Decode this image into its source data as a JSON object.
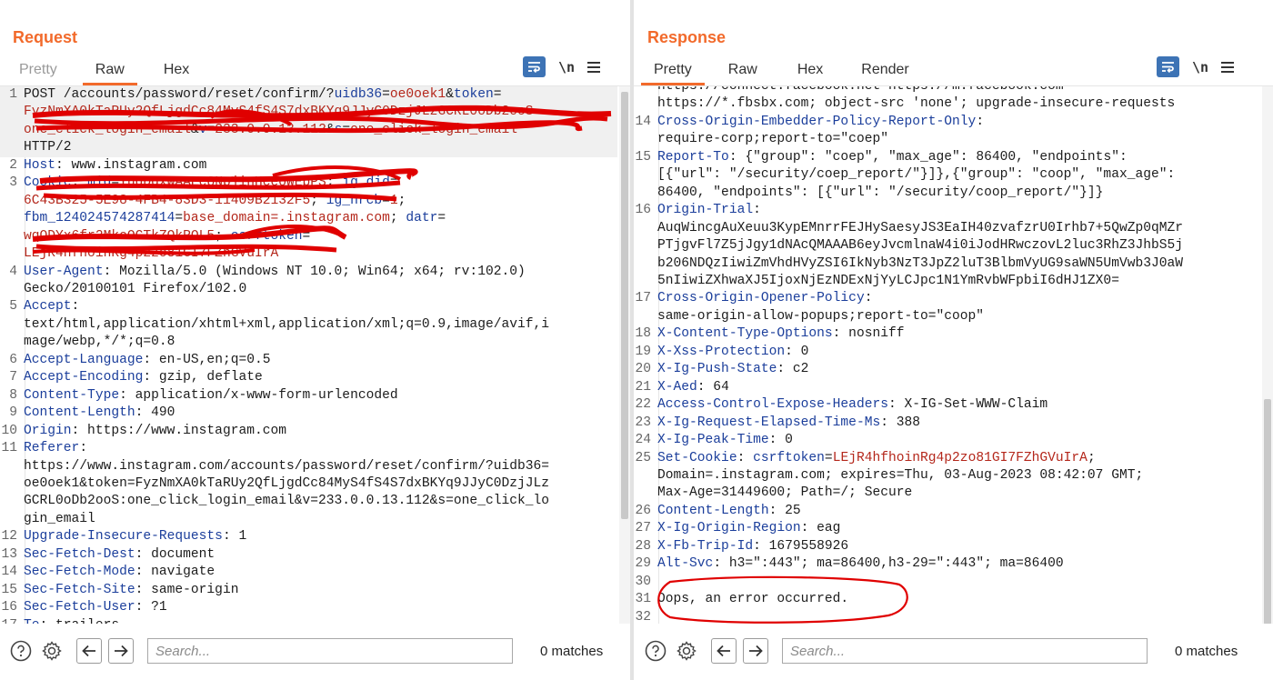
{
  "layout_toggle": {
    "options": [
      "side-by-side",
      "horizontal",
      "single"
    ],
    "active": "side-by-side"
  },
  "request": {
    "title": "Request",
    "tabs": [
      {
        "label": "Pretty",
        "active": false,
        "disabled": true
      },
      {
        "label": "Raw",
        "active": true,
        "disabled": false
      },
      {
        "label": "Hex",
        "active": false,
        "disabled": false
      }
    ],
    "newline_label": "\\n",
    "lines": [
      {
        "n": "1",
        "cur": true,
        "segs": [
          [
            "t",
            "POST /accounts/password/reset/confirm/?"
          ],
          [
            "k",
            "uidb36"
          ],
          [
            "t",
            "="
          ],
          [
            "v",
            "oe0oek1"
          ],
          [
            "t",
            "&"
          ],
          [
            "k",
            "token"
          ],
          [
            "t",
            "="
          ]
        ]
      },
      {
        "n": "",
        "cur": true,
        "segs": [
          [
            "v",
            "FyzNmXA0kTaRUy2QfLjgdCc84MyS4fS4S7dxBKYq9JJyC0DzjJLzGCRL0oDb2ooS"
          ]
        ]
      },
      {
        "n": "",
        "cur": true,
        "segs": [
          [
            "v",
            "one_click_login_email"
          ],
          [
            "t",
            "&"
          ],
          [
            "k",
            "v"
          ],
          [
            "t",
            "="
          ],
          [
            "v",
            "233.0.0.13.112"
          ],
          [
            "t",
            "&"
          ],
          [
            "k",
            "s"
          ],
          [
            "t",
            "="
          ],
          [
            "v",
            "one_click_login_email"
          ]
        ]
      },
      {
        "n": "",
        "cur": true,
        "segs": [
          [
            "t",
            "HTTP/2"
          ]
        ]
      },
      {
        "n": "2",
        "segs": [
          [
            "h",
            "Host"
          ],
          [
            "t",
            ": www.instagram.com"
          ]
        ]
      },
      {
        "n": "3",
        "segs": [
          [
            "h",
            "Cookie"
          ],
          [
            "t",
            ": "
          ],
          [
            "k",
            "mid"
          ],
          [
            "t",
            "="
          ],
          [
            "v",
            "YuqDqxWAAEc8NpjinHceoWEbPS"
          ],
          [
            "t",
            "; "
          ],
          [
            "k",
            "ig_did"
          ],
          [
            "t",
            "="
          ]
        ]
      },
      {
        "n": "",
        "segs": [
          [
            "v",
            "6C43B325-5E98-4FB4-83D3-11409B2132F5"
          ],
          [
            "t",
            "; "
          ],
          [
            "k",
            "ig_nrcb"
          ],
          [
            "t",
            "="
          ],
          [
            "v",
            "1"
          ],
          [
            "t",
            ";"
          ]
        ]
      },
      {
        "n": "",
        "segs": [
          [
            "k",
            "fbm_124024574287414"
          ],
          [
            "t",
            "="
          ],
          [
            "v",
            "base_domain=.instagram.com"
          ],
          [
            "t",
            "; "
          ],
          [
            "k",
            "datr"
          ],
          [
            "t",
            "="
          ]
        ]
      },
      {
        "n": "",
        "segs": [
          [
            "v",
            "wqODYx6fr2MkoOCTkZQkROL5"
          ],
          [
            "t",
            "; "
          ],
          [
            "k",
            "csrftoken"
          ],
          [
            "t",
            "="
          ]
        ]
      },
      {
        "n": "",
        "segs": [
          [
            "v",
            "LEjR4hfhoinRg4p2zo81GI7FZhGVuIrA"
          ]
        ]
      },
      {
        "n": "4",
        "segs": [
          [
            "h",
            "User-Agent"
          ],
          [
            "t",
            ": Mozilla/5.0 (Windows NT 10.0; Win64; x64; rv:102.0)"
          ]
        ]
      },
      {
        "n": "",
        "segs": [
          [
            "t",
            "Gecko/20100101 Firefox/102.0"
          ]
        ]
      },
      {
        "n": "5",
        "segs": [
          [
            "h",
            "Accept"
          ],
          [
            "t",
            ":"
          ]
        ]
      },
      {
        "n": "",
        "segs": [
          [
            "t",
            "text/html,application/xhtml+xml,application/xml;q=0.9,image/avif,i"
          ]
        ]
      },
      {
        "n": "",
        "segs": [
          [
            "t",
            "mage/webp,*/*;q=0.8"
          ]
        ]
      },
      {
        "n": "6",
        "segs": [
          [
            "h",
            "Accept-Language"
          ],
          [
            "t",
            ": en-US,en;q=0.5"
          ]
        ]
      },
      {
        "n": "7",
        "segs": [
          [
            "h",
            "Accept-Encoding"
          ],
          [
            "t",
            ": gzip, deflate"
          ]
        ]
      },
      {
        "n": "8",
        "segs": [
          [
            "h",
            "Content-Type"
          ],
          [
            "t",
            ": application/x-www-form-urlencoded"
          ]
        ]
      },
      {
        "n": "9",
        "segs": [
          [
            "h",
            "Content-Length"
          ],
          [
            "t",
            ": 490"
          ]
        ]
      },
      {
        "n": "10",
        "segs": [
          [
            "h",
            "Origin"
          ],
          [
            "t",
            ": https://www.instagram.com"
          ]
        ]
      },
      {
        "n": "11",
        "segs": [
          [
            "h",
            "Referer"
          ],
          [
            "t",
            ":"
          ]
        ]
      },
      {
        "n": "",
        "segs": [
          [
            "t",
            "https://www.instagram.com/accounts/password/reset/confirm/?uidb36="
          ]
        ]
      },
      {
        "n": "",
        "segs": [
          [
            "t",
            "oe0oek1&token=FyzNmXA0kTaRUy2QfLjgdCc84MyS4fS4S7dxBKYq9JJyC0DzjJLz"
          ]
        ]
      },
      {
        "n": "",
        "segs": [
          [
            "t",
            "GCRL0oDb2ooS:one_click_login_email&v=233.0.0.13.112&s=one_click_lo"
          ]
        ]
      },
      {
        "n": "",
        "segs": [
          [
            "t",
            "gin_email"
          ]
        ]
      },
      {
        "n": "12",
        "segs": [
          [
            "h",
            "Upgrade-Insecure-Requests"
          ],
          [
            "t",
            ": 1"
          ]
        ]
      },
      {
        "n": "13",
        "segs": [
          [
            "h",
            "Sec-Fetch-Dest"
          ],
          [
            "t",
            ": document"
          ]
        ]
      },
      {
        "n": "14",
        "segs": [
          [
            "h",
            "Sec-Fetch-Mode"
          ],
          [
            "t",
            ": navigate"
          ]
        ]
      },
      {
        "n": "15",
        "segs": [
          [
            "h",
            "Sec-Fetch-Site"
          ],
          [
            "t",
            ": same-origin"
          ]
        ]
      },
      {
        "n": "16",
        "segs": [
          [
            "h",
            "Sec-Fetch-User"
          ],
          [
            "t",
            ": ?1"
          ]
        ]
      },
      {
        "n": "17",
        "segs": [
          [
            "h",
            "Te"
          ],
          [
            "t",
            ": trailers"
          ]
        ]
      }
    ],
    "search": {
      "placeholder": "Search...",
      "value": ""
    },
    "matches": "0 matches"
  },
  "response": {
    "title": "Response",
    "tabs": [
      {
        "label": "Pretty",
        "active": true,
        "disabled": false
      },
      {
        "label": "Raw",
        "active": false,
        "disabled": false
      },
      {
        "label": "Hex",
        "active": false,
        "disabled": false
      },
      {
        "label": "Render",
        "active": false,
        "disabled": false
      }
    ],
    "newline_label": "\\n",
    "lines": [
      {
        "n": "",
        "segs": [
          [
            "t",
            "https://connect.facebook.net https://m.facebook.com"
          ]
        ]
      },
      {
        "n": "",
        "segs": [
          [
            "t",
            "https://*.fbsbx.com; object-src 'none'; upgrade-insecure-requests"
          ]
        ]
      },
      {
        "n": "14",
        "segs": [
          [
            "h",
            "Cross-Origin-Embedder-Policy-Report-Only"
          ],
          [
            "t",
            ":"
          ]
        ]
      },
      {
        "n": "",
        "segs": [
          [
            "t",
            "require-corp;report-to=\"coep\""
          ]
        ]
      },
      {
        "n": "15",
        "segs": [
          [
            "h",
            "Report-To"
          ],
          [
            "t",
            ": {\"group\": \"coep\", \"max_age\": 86400, \"endpoints\":"
          ]
        ]
      },
      {
        "n": "",
        "segs": [
          [
            "t",
            "[{\"url\": \"/security/coep_report/\"}]},{\"group\": \"coop\", \"max_age\":"
          ]
        ]
      },
      {
        "n": "",
        "segs": [
          [
            "t",
            "86400, \"endpoints\": [{\"url\": \"/security/coop_report/\"}]}"
          ]
        ]
      },
      {
        "n": "16",
        "segs": [
          [
            "h",
            "Origin-Trial"
          ],
          [
            "t",
            ":"
          ]
        ]
      },
      {
        "n": "",
        "segs": [
          [
            "t",
            "AuqWincgAuXeuu3KypEMnrrFEJHySaesyJS3EaIH40zvafzrU0Irhb7+5QwZp0qMZr"
          ]
        ]
      },
      {
        "n": "",
        "segs": [
          [
            "t",
            "PTjgvFl7Z5jJgy1dNAcQMAAAB6eyJvcmlnaW4i0iJodHRwczovL2luc3RhZ3JhbS5j"
          ]
        ]
      },
      {
        "n": "",
        "segs": [
          [
            "t",
            "b206NDQzIiwiZmVhdHVyZSI6IkNyb3NzT3JpZ2luT3BlbmVyUG9saWN5UmVwb3J0aW"
          ]
        ]
      },
      {
        "n": "",
        "segs": [
          [
            "t",
            "5nIiwiZXhwaXJ5IjoxNjEzNDExNjYyLCJpc1N1YmRvbWFpbiI6dHJ1ZX0="
          ]
        ]
      },
      {
        "n": "17",
        "segs": [
          [
            "h",
            "Cross-Origin-Opener-Policy"
          ],
          [
            "t",
            ":"
          ]
        ]
      },
      {
        "n": "",
        "segs": [
          [
            "t",
            "same-origin-allow-popups;report-to=\"coop\""
          ]
        ]
      },
      {
        "n": "18",
        "segs": [
          [
            "h",
            "X-Content-Type-Options"
          ],
          [
            "t",
            ": nosniff"
          ]
        ]
      },
      {
        "n": "19",
        "segs": [
          [
            "h",
            "X-Xss-Protection"
          ],
          [
            "t",
            ": 0"
          ]
        ]
      },
      {
        "n": "20",
        "segs": [
          [
            "h",
            "X-Ig-Push-State"
          ],
          [
            "t",
            ": c2"
          ]
        ]
      },
      {
        "n": "21",
        "segs": [
          [
            "h",
            "X-Aed"
          ],
          [
            "t",
            ": 64"
          ]
        ]
      },
      {
        "n": "22",
        "segs": [
          [
            "h",
            "Access-Control-Expose-Headers"
          ],
          [
            "t",
            ": X-IG-Set-WWW-Claim"
          ]
        ]
      },
      {
        "n": "23",
        "segs": [
          [
            "h",
            "X-Ig-Request-Elapsed-Time-Ms"
          ],
          [
            "t",
            ": 388"
          ]
        ]
      },
      {
        "n": "24",
        "segs": [
          [
            "h",
            "X-Ig-Peak-Time"
          ],
          [
            "t",
            ": 0"
          ]
        ]
      },
      {
        "n": "25",
        "segs": [
          [
            "h",
            "Set-Cookie"
          ],
          [
            "t",
            ": "
          ],
          [
            "k",
            "csrftoken"
          ],
          [
            "t",
            "="
          ],
          [
            "v",
            "LEjR4hfhoinRg4p2zo81GI7FZhGVuIrA"
          ],
          [
            "t",
            ";"
          ]
        ]
      },
      {
        "n": "",
        "segs": [
          [
            "t",
            "Domain=.instagram.com; expires=Thu, 03-Aug-2023 08:42:07 GMT;"
          ]
        ]
      },
      {
        "n": "",
        "segs": [
          [
            "t",
            "Max-Age=31449600; Path=/; Secure"
          ]
        ]
      },
      {
        "n": "26",
        "segs": [
          [
            "h",
            "Content-Length"
          ],
          [
            "t",
            ": 25"
          ]
        ]
      },
      {
        "n": "27",
        "segs": [
          [
            "h",
            "X-Ig-Origin-Region"
          ],
          [
            "t",
            ": eag"
          ]
        ]
      },
      {
        "n": "28",
        "segs": [
          [
            "h",
            "X-Fb-Trip-Id"
          ],
          [
            "t",
            ": 1679558926"
          ]
        ]
      },
      {
        "n": "29",
        "segs": [
          [
            "h",
            "Alt-Svc"
          ],
          [
            "t",
            ": h3=\":443\"; ma=86400,h3-29=\":443\"; ma=86400"
          ]
        ]
      },
      {
        "n": "30",
        "segs": [
          [
            "t",
            ""
          ]
        ]
      },
      {
        "n": "31",
        "segs": [
          [
            "t",
            "Oops, an error occurred."
          ]
        ]
      },
      {
        "n": "32",
        "segs": [
          [
            "t",
            ""
          ]
        ]
      }
    ],
    "search": {
      "placeholder": "Search...",
      "value": ""
    },
    "matches": "0 matches"
  },
  "colors": {
    "accent": "#f26a2b",
    "header_name": "#1b3e9b",
    "param_value": "#b4271b",
    "wrap_button": "#3d73b5",
    "annotation": "#e00000"
  },
  "icons": {
    "help": "help-icon",
    "settings": "gear-icon",
    "back": "arrow-left-icon",
    "forward": "arrow-right-icon",
    "wrap": "wrap-lines-icon",
    "menu": "hamburger-menu-icon"
  }
}
